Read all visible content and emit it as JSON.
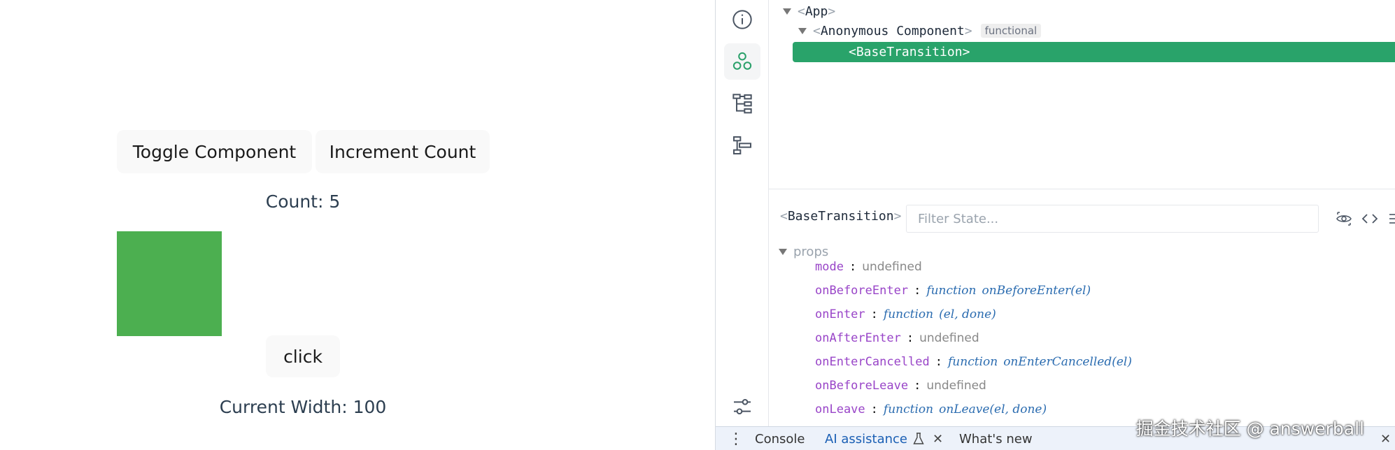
{
  "app": {
    "toggle_label": "Toggle Component",
    "increment_label": "Increment Count",
    "count_text": "Count: 5",
    "box_color": "#4caf50",
    "click_label": "click",
    "width_text": "Current Width: 100"
  },
  "devtools": {
    "sidebar": {
      "icons": [
        "info-icon",
        "components-icon",
        "component-tree-icon",
        "timeline-icon",
        "settings-icon"
      ]
    },
    "tree": {
      "root": "App",
      "child": "Anonymous Component",
      "child_badge": "functional",
      "selected": "BaseTransition"
    },
    "inspector": {
      "component": "BaseTransition",
      "filter_placeholder": "Filter State...",
      "section": "props",
      "props": [
        {
          "key": "mode",
          "value": "undefined"
        },
        {
          "key": "onBeforeEnter",
          "fn_kw": "function",
          "fn_sig": "onBeforeEnter(el)"
        },
        {
          "key": "onEnter",
          "fn_kw": "function",
          "fn_sig": "(el, done)"
        },
        {
          "key": "onAfterEnter",
          "value": "undefined"
        },
        {
          "key": "onEnterCancelled",
          "fn_kw": "function",
          "fn_sig": "onEnterCancelled(el)"
        },
        {
          "key": "onBeforeLeave",
          "value": "undefined"
        },
        {
          "key": "onLeave",
          "fn_kw": "function",
          "fn_sig": "onLeave(el, done)"
        }
      ]
    },
    "drawer": {
      "menu_glyph": "⋮",
      "tabs": [
        "Console",
        "AI assistance",
        "What's new"
      ],
      "close_glyph": "✕"
    },
    "accent": "#29a36a"
  },
  "watermark": "掘金技术社区 @ answerball"
}
